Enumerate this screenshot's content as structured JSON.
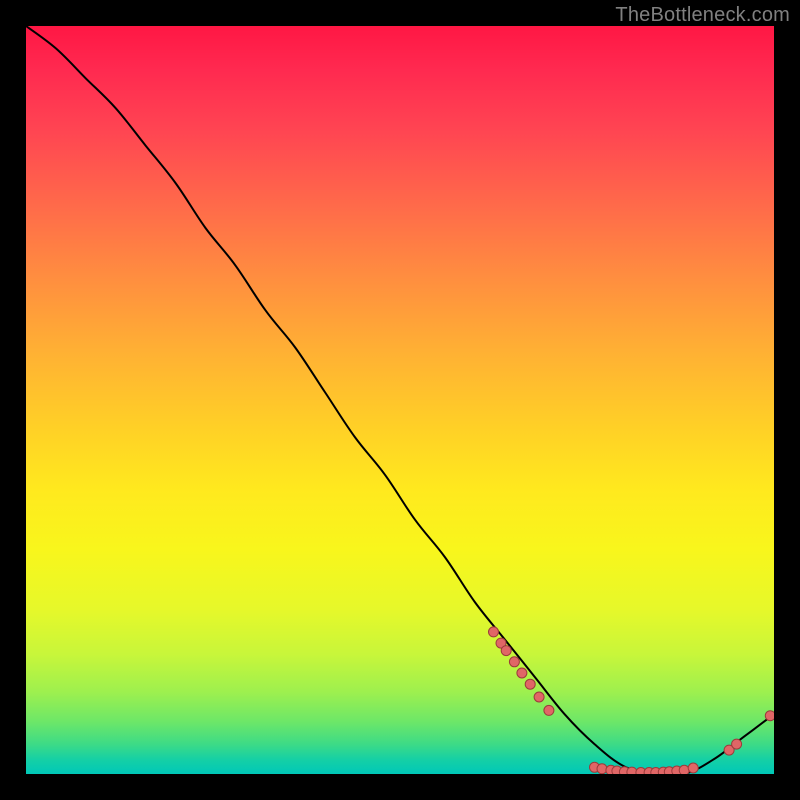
{
  "attribution": "TheBottleneck.com",
  "colors": {
    "background": "#000000",
    "gradient_top": "#ff1744",
    "gradient_mid": "#ffe91e",
    "gradient_bottom": "#00c8b8",
    "curve": "#000000",
    "markers": "#e06666",
    "markers_stroke": "#9c3b3b"
  },
  "chart_data": {
    "type": "line",
    "title": "",
    "xlabel": "",
    "ylabel": "",
    "xlim": [
      0,
      100
    ],
    "ylim": [
      0,
      100
    ],
    "grid": false,
    "note": "Axes are unlabeled in the source image; values are normalized 0–100 positions read from geometry.",
    "series": [
      {
        "name": "bottleneck-curve",
        "x": [
          0,
          4,
          8,
          12,
          16,
          20,
          24,
          28,
          32,
          36,
          40,
          44,
          48,
          52,
          56,
          60,
          64,
          68,
          72,
          76,
          80,
          84,
          88,
          92,
          96,
          100
        ],
        "y": [
          100,
          97,
          93,
          89,
          84,
          79,
          73,
          68,
          62,
          57,
          51,
          45,
          40,
          34,
          29,
          23,
          18,
          13,
          8,
          4,
          1,
          0,
          0,
          2,
          5,
          8
        ]
      }
    ],
    "marker_clusters": [
      {
        "name": "left-descent-cluster",
        "points": [
          {
            "x": 62.5,
            "y": 19.0
          },
          {
            "x": 63.5,
            "y": 17.5
          },
          {
            "x": 64.2,
            "y": 16.5
          },
          {
            "x": 65.3,
            "y": 15.0
          },
          {
            "x": 66.3,
            "y": 13.5
          },
          {
            "x": 67.4,
            "y": 12.0
          },
          {
            "x": 68.6,
            "y": 10.3
          },
          {
            "x": 69.9,
            "y": 8.5
          }
        ]
      },
      {
        "name": "valley-cluster",
        "points": [
          {
            "x": 76.0,
            "y": 0.9
          },
          {
            "x": 77.0,
            "y": 0.7
          },
          {
            "x": 78.2,
            "y": 0.5
          },
          {
            "x": 79.0,
            "y": 0.4
          },
          {
            "x": 80.0,
            "y": 0.3
          },
          {
            "x": 81.0,
            "y": 0.25
          },
          {
            "x": 82.2,
            "y": 0.2
          },
          {
            "x": 83.3,
            "y": 0.2
          },
          {
            "x": 84.2,
            "y": 0.2
          },
          {
            "x": 85.2,
            "y": 0.25
          },
          {
            "x": 86.0,
            "y": 0.3
          },
          {
            "x": 87.0,
            "y": 0.4
          },
          {
            "x": 88.0,
            "y": 0.5
          },
          {
            "x": 89.2,
            "y": 0.8
          }
        ]
      },
      {
        "name": "right-rise-cluster",
        "points": [
          {
            "x": 94.0,
            "y": 3.2
          },
          {
            "x": 95.0,
            "y": 4.0
          },
          {
            "x": 99.5,
            "y": 7.8
          }
        ]
      }
    ]
  }
}
